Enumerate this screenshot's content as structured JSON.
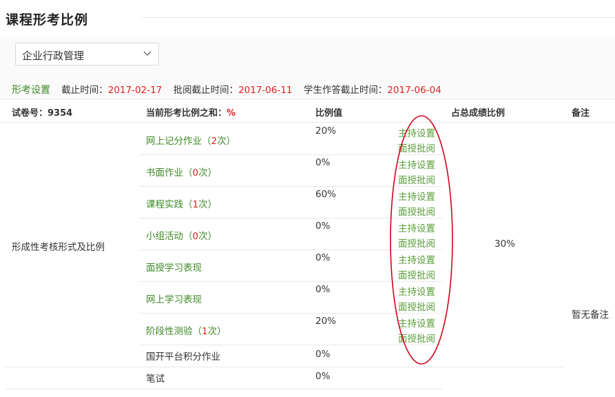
{
  "header": {
    "title": "课程形考比例"
  },
  "course_select": {
    "value": "企业行政管理"
  },
  "info": {
    "tab_label": "形考设置",
    "deadline_label": "截止时间：",
    "deadline": "2017-02-17",
    "review_label": "批阅截止时间：",
    "review_deadline": "2017-06-11",
    "student_label": "学生作答截止时间：",
    "student_deadline": "2017-06-04"
  },
  "table": {
    "col_paper": "试卷号：9354",
    "col_sum": "当前形考比例之和：",
    "col_sum_pct": "%",
    "col_ratio": "比例值",
    "col_total": "占总成绩比例",
    "col_note": "备注",
    "group_label": "形成性考核形式及比例",
    "total_value": "30%",
    "note_value": "暂无备注",
    "action_set": "主持设置",
    "action_review": "面授批阅",
    "rows": [
      {
        "name": "网上记分作业",
        "open": "（",
        "count": "2",
        "close": "次）",
        "value": "20%"
      },
      {
        "name": "书面作业",
        "open": "（",
        "count": "0",
        "close": "次）",
        "value": "0%"
      },
      {
        "name": "课程实践",
        "open": "（",
        "count": "1",
        "close": "次）",
        "value": "60%"
      },
      {
        "name": "小组活动",
        "open": "（",
        "count": "0",
        "close": "次）",
        "value": "0%"
      },
      {
        "name": "面授学习表现",
        "value": "0%"
      },
      {
        "name": "网上学习表现",
        "value": "0%"
      },
      {
        "name": "阶段性测验",
        "open": "（",
        "count": "1",
        "close": "次）",
        "value": "20%"
      },
      {
        "name": "国开平台积分作业",
        "value": "0%"
      },
      {
        "name": "笔试",
        "value": "0%"
      }
    ]
  },
  "annotation": {
    "color": "#d0021b"
  }
}
